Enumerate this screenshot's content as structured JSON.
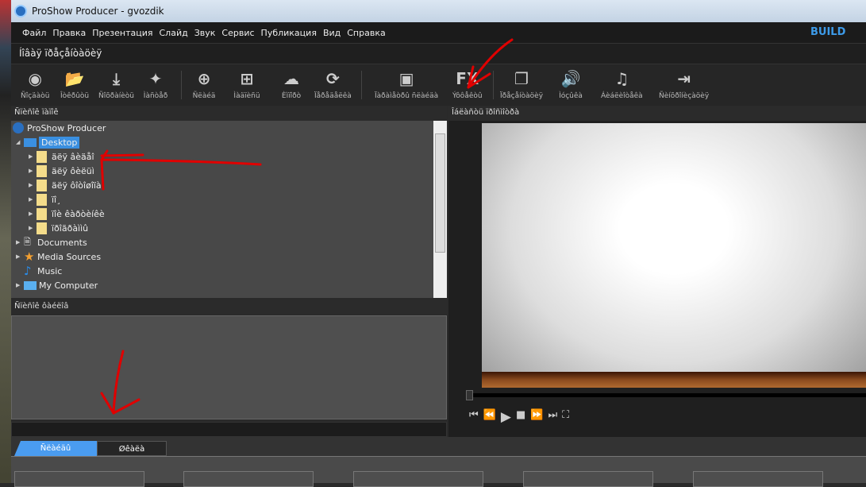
{
  "window": {
    "title": "ProShow Producer - gvozdik"
  },
  "menu": [
    "Файл",
    "Правка",
    "Презентация",
    "Слайд",
    "Звук",
    "Сервис",
    "Публикация",
    "Вид",
    "Справка"
  ],
  "mode": "BUILD",
  "project_title": "Íîâàÿ ïðåçåíòàöèÿ",
  "toolbar": [
    {
      "label": "Ñîçäàòü",
      "icon": "create-show-icon"
    },
    {
      "label": "Îòêðûòü",
      "icon": "open-folder-icon"
    },
    {
      "label": "Ñîõðàíèòü",
      "icon": "save-icon"
    },
    {
      "label": "Ìàñòåð",
      "icon": "wizard-icon"
    },
    {
      "label": "Ñëàéä",
      "icon": "add-slide-icon"
    },
    {
      "label": "Ìàäïèñü",
      "icon": "caption-icon"
    },
    {
      "label": "Èìïîðò",
      "icon": "import-cloud-icon"
    },
    {
      "label": "Ïåðåäåëêà",
      "icon": "remake-icon"
    },
    {
      "label": "Ïàðàìåòðû ñëàéäà",
      "icon": "slide-options-icon"
    },
    {
      "label": "Ýôôåêòû",
      "icon": "fx-icon"
    },
    {
      "label": "Ïðåçåíòàöèÿ",
      "icon": "show-options-icon"
    },
    {
      "label": "Ìóçûêà",
      "icon": "music-icon"
    },
    {
      "label": "Áèáëèîòåêà",
      "icon": "library-icon"
    },
    {
      "label": "Ñèíõðîíèçàöèÿ",
      "icon": "sync-icon"
    }
  ],
  "folders_panel": {
    "title": "Ñïèñîê ïàïîê",
    "items": [
      {
        "label": "ProShow Producer",
        "level": 0
      },
      {
        "label": "Desktop",
        "level": 1,
        "selected": true
      },
      {
        "label": "äëÿ âèäåî",
        "level": 2
      },
      {
        "label": "äëÿ ôèëüì",
        "level": 2
      },
      {
        "label": "äëÿ ôîòîøîïà",
        "level": 2
      },
      {
        "label": "ïî¸",
        "level": 2
      },
      {
        "label": "ïîè êàðòèíêè",
        "level": 2
      },
      {
        "label": "ïðîãðàììû",
        "level": 2
      },
      {
        "label": "Documents",
        "level": 1
      },
      {
        "label": "Media Sources",
        "level": 1
      },
      {
        "label": "Music",
        "level": 1
      },
      {
        "label": "My Computer",
        "level": 1
      }
    ]
  },
  "files_panel": {
    "title": "Ñïèñîê ôàéëîâ"
  },
  "preview_panel": {
    "title": "Îáëàñòü ïðîñìîòðà",
    "position": 0
  },
  "tabs": [
    {
      "label": "Ñëàéäû",
      "active": true
    },
    {
      "label": "Øêàëà",
      "active": false
    }
  ],
  "colors": {
    "accent": "#3d9be9",
    "annotation": "#e00000"
  }
}
